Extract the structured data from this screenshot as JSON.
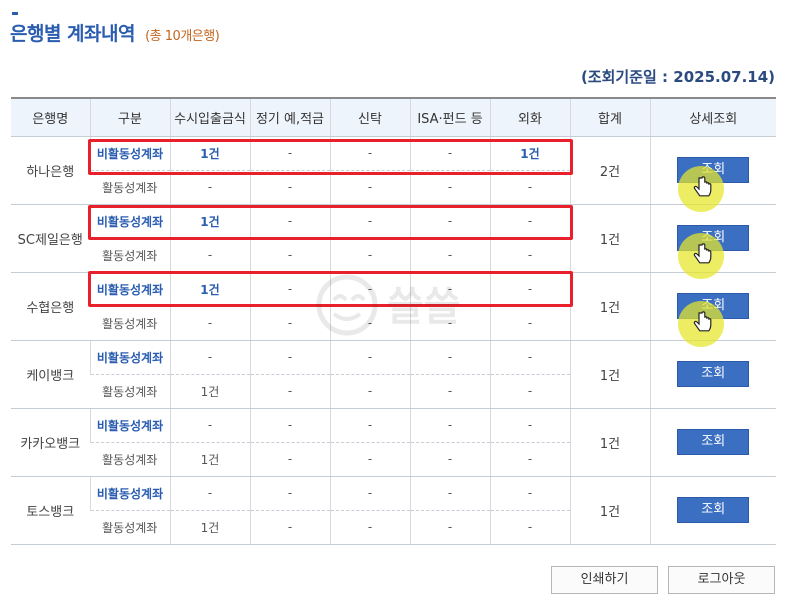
{
  "page": {
    "title": "은행별 계좌내역",
    "subtitle": "(총 10개은행)",
    "reference_date": "(조회기준일 : 2025.07.14)"
  },
  "table": {
    "headers": [
      "은행명",
      "구분",
      "수시입출금식",
      "정기 예,적금",
      "신탁",
      "ISA·펀드 등",
      "외화",
      "합계",
      "상세조회"
    ],
    "banks": [
      {
        "name": "하나은행",
        "total": "2건",
        "button": "조회",
        "rows": [
          {
            "type": "비활동성계좌",
            "values": [
              "1건",
              "-",
              "-",
              "-",
              "1건"
            ]
          },
          {
            "type": "활동성계좌",
            "values": [
              "-",
              "-",
              "-",
              "-",
              "-"
            ]
          }
        ]
      },
      {
        "name": "SC제일은행",
        "total": "1건",
        "button": "조회",
        "rows": [
          {
            "type": "비활동성계좌",
            "values": [
              "1건",
              "-",
              "-",
              "-",
              "-"
            ]
          },
          {
            "type": "활동성계좌",
            "values": [
              "-",
              "-",
              "-",
              "-",
              "-"
            ]
          }
        ]
      },
      {
        "name": "수협은행",
        "total": "1건",
        "button": "조회",
        "rows": [
          {
            "type": "비활동성계좌",
            "values": [
              "1건",
              "-",
              "-",
              "-",
              "-"
            ]
          },
          {
            "type": "활동성계좌",
            "values": [
              "-",
              "-",
              "-",
              "-",
              "-"
            ]
          }
        ]
      },
      {
        "name": "케이뱅크",
        "total": "1건",
        "button": "조회",
        "rows": [
          {
            "type": "비활동성계좌",
            "values": [
              "-",
              "-",
              "-",
              "-",
              "-"
            ]
          },
          {
            "type": "활동성계좌",
            "values": [
              "1건",
              "-",
              "-",
              "-",
              "-"
            ]
          }
        ]
      },
      {
        "name": "카카오뱅크",
        "total": "1건",
        "button": "조회",
        "rows": [
          {
            "type": "비활동성계좌",
            "values": [
              "-",
              "-",
              "-",
              "-",
              "-"
            ]
          },
          {
            "type": "활동성계좌",
            "values": [
              "1건",
              "-",
              "-",
              "-",
              "-"
            ]
          }
        ]
      },
      {
        "name": "토스뱅크",
        "total": "1건",
        "button": "조회",
        "rows": [
          {
            "type": "비활동성계좌",
            "values": [
              "-",
              "-",
              "-",
              "-",
              "-"
            ]
          },
          {
            "type": "활동성계좌",
            "values": [
              "1건",
              "-",
              "-",
              "-",
              "-"
            ]
          }
        ]
      }
    ]
  },
  "footer": {
    "print_label": "인쇄하기",
    "logout_label": "로그아웃"
  },
  "icons": {
    "cursor": "hand-pointer-icon",
    "watermark": "watermark-logo"
  },
  "colors": {
    "accent": "#2a5db0",
    "highlight_box": "#e8202b",
    "cursor_highlight": "#e6e628",
    "button_bg": "#3b6fc2",
    "subtitle": "#c4661f"
  }
}
